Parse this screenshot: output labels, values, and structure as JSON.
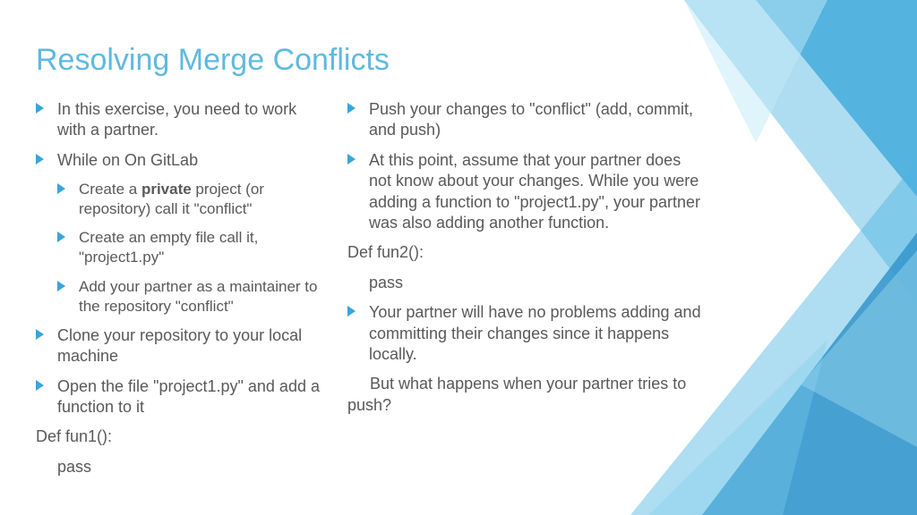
{
  "title": "Resolving Merge Conflicts",
  "left": {
    "b1": "In this exercise, you need to work with a partner.",
    "b2": "While on On GitLab",
    "b2a_pre": "Create a ",
    "b2a_bold": "private",
    "b2a_post": " project (or repository) call it \"conflict\"",
    "b2b": "Create an empty file call it, \"project1.py\"",
    "b2c": "Add your partner as a maintainer to the repository \"conflict\"",
    "b3": "Clone your repository to your local machine",
    "b4": "Open the file \"project1.py\" and add a function to it",
    "code1": "Def fun1():",
    "code2": "pass"
  },
  "right": {
    "b1": "Push your changes to \"conflict\" (add, commit, and push)",
    "b2": "At this point, assume that your partner does not know about your changes. While you were adding a function to \"project1.py\", your partner was also adding another function.",
    "code1": "Def fun2():",
    "code2": "pass",
    "b3": "Your partner will have no problems adding and committing their changes since it happens locally.",
    "q": "     But what happens when your partner tries to push?"
  }
}
